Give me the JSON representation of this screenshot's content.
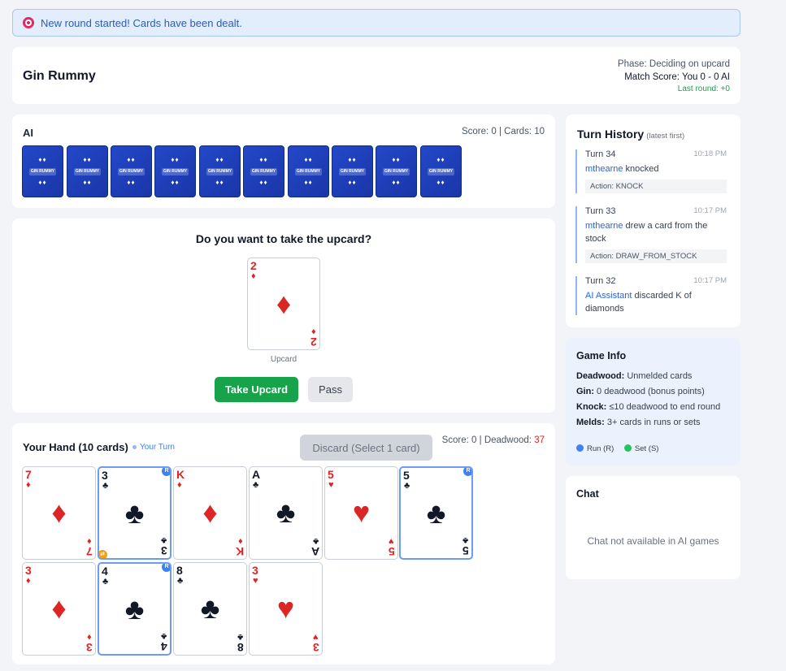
{
  "notification": {
    "text": "New round started! Cards have been dealt."
  },
  "header": {
    "title": "Gin Rummy",
    "phase": "Phase: Deciding on upcard",
    "match_score": "Match Score: You 0 - 0 AI",
    "last_round": "Last round: +0"
  },
  "opponent": {
    "name": "AI",
    "stats": "Score: 0 | Cards: 10",
    "card_back_label": "GIN RUMMY",
    "card_count": 10
  },
  "upcard_prompt": {
    "question": "Do you want to take the upcard?",
    "card": {
      "rank": "2",
      "suit": "♦",
      "color": "red"
    },
    "caption": "Upcard",
    "take_label": "Take Upcard",
    "pass_label": "Pass"
  },
  "hand": {
    "title": "Your Hand (10 cards)",
    "turn_indicator": "Your Turn",
    "discard_label": "Discard (Select 1 card)",
    "score_text": "Score: 0 | Deadwood: ",
    "deadwood_value": "37",
    "cards": [
      {
        "rank": "7",
        "suit": "♦",
        "color": "red",
        "selected": false,
        "badge": "",
        "swap": false
      },
      {
        "rank": "3",
        "suit": "♣",
        "color": "black",
        "selected": true,
        "badge": "R",
        "swap": true
      },
      {
        "rank": "K",
        "suit": "♦",
        "color": "red",
        "selected": false,
        "badge": "",
        "swap": false
      },
      {
        "rank": "A",
        "suit": "♣",
        "color": "black",
        "selected": false,
        "badge": "",
        "swap": false
      },
      {
        "rank": "5",
        "suit": "♥",
        "color": "red",
        "selected": false,
        "badge": "",
        "swap": false
      },
      {
        "rank": "5",
        "suit": "♣",
        "color": "black",
        "selected": true,
        "badge": "R",
        "swap": false
      },
      {
        "rank": "3",
        "suit": "♦",
        "color": "red",
        "selected": false,
        "badge": "",
        "swap": false
      },
      {
        "rank": "4",
        "suit": "♣",
        "color": "black",
        "selected": true,
        "badge": "R",
        "swap": false
      },
      {
        "rank": "8",
        "suit": "♣",
        "color": "black",
        "selected": false,
        "badge": "",
        "swap": false
      },
      {
        "rank": "3",
        "suit": "♥",
        "color": "red",
        "selected": false,
        "badge": "",
        "swap": false
      }
    ]
  },
  "history": {
    "title": "Turn History",
    "subtitle": "(latest first)",
    "entries": [
      {
        "turn": "Turn 34",
        "time": "10:18 PM",
        "user": "mthearne",
        "text": " knocked",
        "action": "Action: KNOCK"
      },
      {
        "turn": "Turn 33",
        "time": "10:17 PM",
        "user": "mthearne",
        "text": " drew a card from the stock",
        "action": "Action: DRAW_FROM_STOCK"
      },
      {
        "turn": "Turn 32",
        "time": "10:17 PM",
        "user": "AI Assistant",
        "text": " discarded K of diamonds",
        "action": ""
      }
    ]
  },
  "game_info": {
    "title": "Game Info",
    "items": [
      {
        "term": "Deadwood:",
        "desc": " Unmelded cards"
      },
      {
        "term": "Gin:",
        "desc": " 0 deadwood (bonus points)"
      },
      {
        "term": "Knock:",
        "desc": " ≤10 deadwood to end round"
      },
      {
        "term": "Melds:",
        "desc": " 3+ cards in runs or sets"
      }
    ],
    "legend": [
      {
        "label": "Run (R)",
        "color": "#3b82f6"
      },
      {
        "label": "Set (S)",
        "color": "#22c55e"
      }
    ]
  },
  "chat": {
    "title": "Chat",
    "empty": "Chat not available in AI games"
  }
}
